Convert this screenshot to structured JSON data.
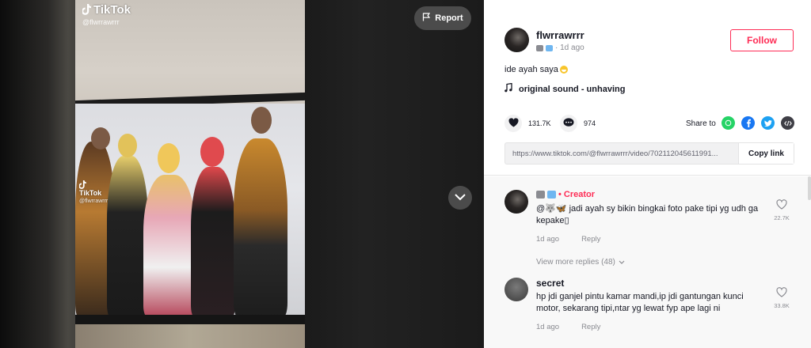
{
  "video": {
    "watermark_logo": "TikTok",
    "watermark_user": "@flwrrawrrr",
    "watermark_user_small": "@flwrrawrrr",
    "report_label": "Report"
  },
  "author": {
    "username": "flwrrawrrr",
    "time_ago": "· 1d ago",
    "follow_label": "Follow"
  },
  "caption": "ide ayah saya",
  "music": "original sound - unhaving",
  "stats": {
    "likes": "131.7K",
    "comments": "974"
  },
  "share": {
    "label": "Share to",
    "icons": [
      "whatsapp-icon",
      "facebook-icon",
      "twitter-icon",
      "embed-icon"
    ]
  },
  "link": {
    "url": "https://www.tiktok.com/@flwrrawrrr/video/702112045611991...",
    "copy_label": "Copy link"
  },
  "comments": [
    {
      "author_badge": "• Creator",
      "text": "@🐺🦋 jadi ayah sy bikin bingkai foto pake tipi yg udh ga kepake▯",
      "time": "1d ago",
      "reply": "Reply",
      "likes": "22.7K"
    },
    {
      "author": "secret",
      "text": "hp jdi ganjel pintu kamar mandi,ip jdi gantungan kunci motor, sekarang tipi,ntar yg lewat fyp ape lagi ni",
      "time": "1d ago",
      "reply": "Reply",
      "likes": "33.8K"
    }
  ],
  "view_more": "View more replies (48)",
  "colors": {
    "accent": "#fe2c55",
    "text": "#161823",
    "muted": "#8a8b91",
    "whatsapp": "#25d366",
    "facebook": "#1877f2",
    "twitter": "#1da1f2",
    "embed": "#3f3f46"
  }
}
